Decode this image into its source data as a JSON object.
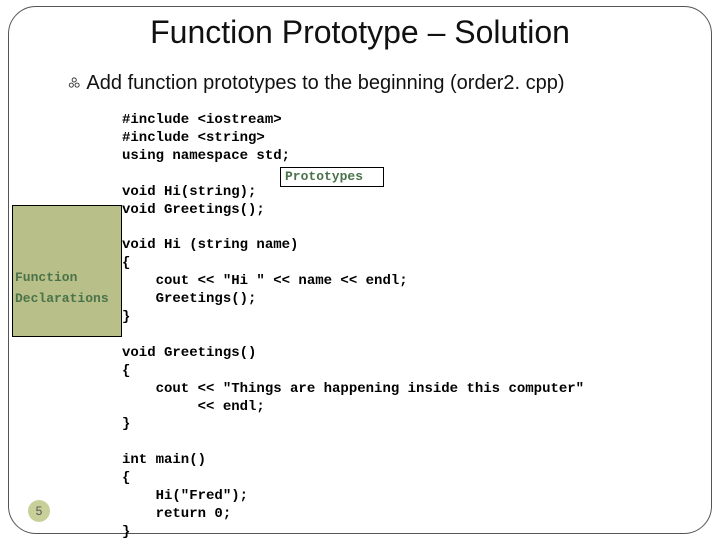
{
  "title": "Function Prototype – Solution",
  "bullet": "Add function prototypes to the beginning (order2. cpp)",
  "code": "#include <iostream>\n#include <string>\nusing namespace std;\n\nvoid Hi(string);\nvoid Greetings();\n\nvoid Hi (string name)\n{\n    cout << \"Hi \" << name << endl;\n    Greetings();\n}\n\nvoid Greetings()\n{\n    cout << \"Things are happening inside this computer\"\n         << endl;\n}\n\nint main()\n{\n    Hi(\"Fred\");\n    return 0;\n}",
  "labels": {
    "prototypes": "Prototypes",
    "function": "Function",
    "declarations": "Declarations"
  },
  "slide_number": "5"
}
